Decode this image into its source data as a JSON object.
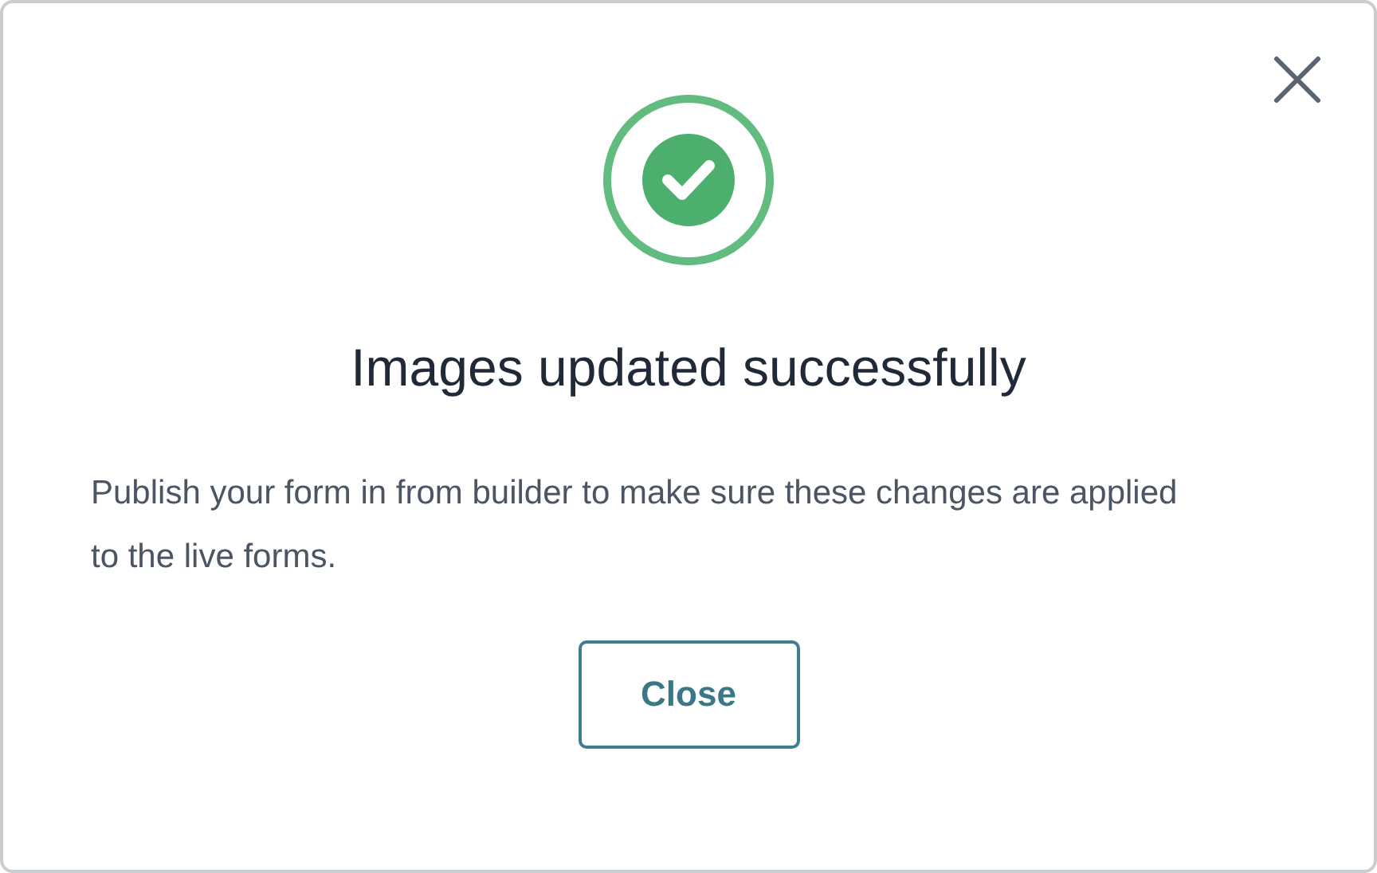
{
  "dialog": {
    "title": "Images updated successfully",
    "message": "Publish your form in from builder to make sure these changes are applied to the live forms.",
    "buttons": [
      "Close"
    ]
  }
}
